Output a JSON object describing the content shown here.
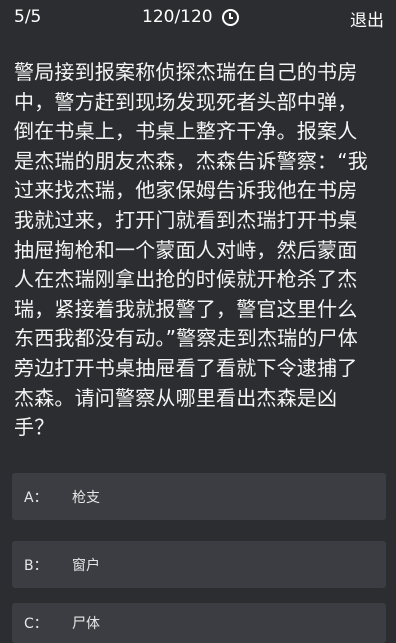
{
  "header": {
    "progress": "5/5",
    "timer": "120/120",
    "timer_icon": "clock-icon",
    "exit_label": "退出"
  },
  "question": {
    "lines": [
      "警局接到报案称侦探杰瑞在自己的书房",
      "中，警方赶到现场发现死者头部中弹，",
      "倒在书桌上，书桌上整齐干净。报案人",
      "是杰瑞的朋友杰森，杰森告诉警察：“我",
      "过来找杰瑞，他家保姆告诉我他在书房",
      "我就过来，打开门就看到杰瑞打开书桌",
      "抽屉掏枪和一个蒙面人对峙，然后蒙面",
      "人在杰瑞刚拿出抢的时候就开枪杀了杰",
      "瑞，紧接着我就报警了，警官这里什么",
      "东西我都没有动。”警察走到杰瑞的尸体",
      "旁边打开书桌抽屉看了看就下令逮捕了",
      "杰森。请问警察从哪里看出杰森是凶",
      "手？"
    ]
  },
  "options": [
    {
      "key": "A：",
      "text": "枪支"
    },
    {
      "key": "B：",
      "text": "窗户"
    },
    {
      "key": "C：",
      "text": "尸体"
    }
  ],
  "colors": {
    "background": "#2b2d31",
    "option_background": "#3b3d42",
    "text": "#ffffff"
  }
}
